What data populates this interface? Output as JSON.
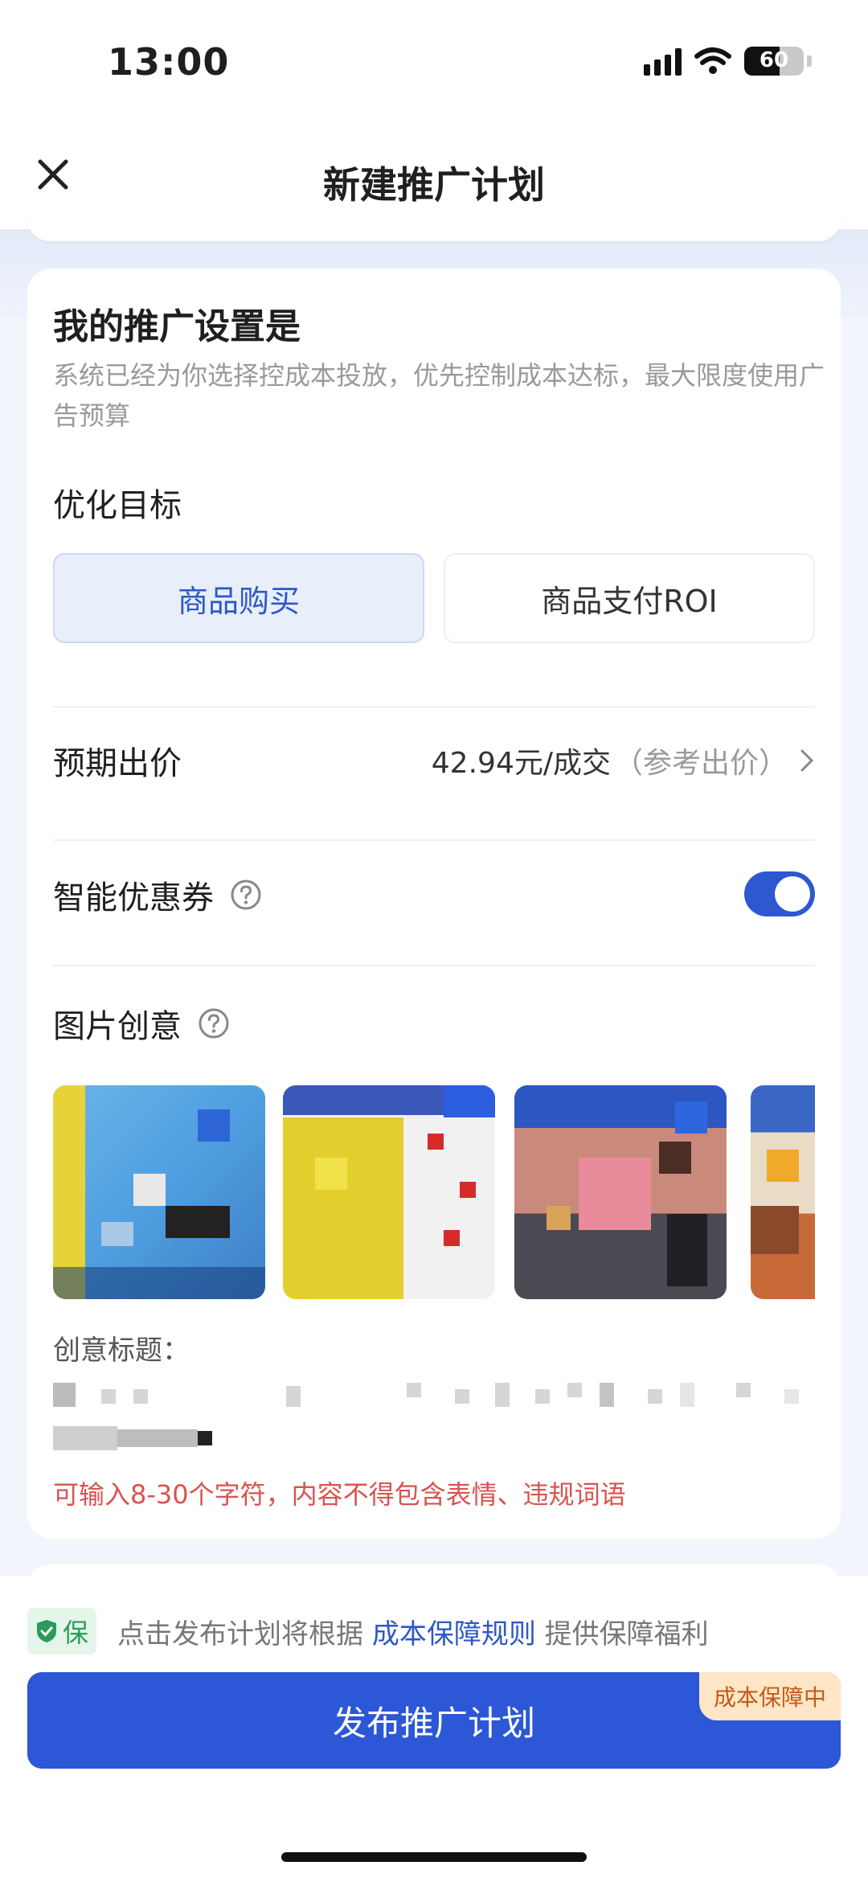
{
  "status_bar": {
    "time": "13:00",
    "battery": "60"
  },
  "nav": {
    "title": "新建推广计划"
  },
  "settings_card": {
    "title": "我的推广设置是",
    "description": "系统已经为你选择控成本投放，优先控制成本达标，最大限度使用广告预算",
    "optimization_goal": {
      "label": "优化目标",
      "options": [
        "商品购买",
        "商品支付ROI"
      ],
      "selected": "商品购买"
    },
    "expected_bid": {
      "label": "预期出价",
      "price": "42.94元/成交",
      "reference": "（参考出价）"
    },
    "smart_coupon": {
      "label": "智能优惠券",
      "enabled": true
    },
    "image_creative": {
      "label": "图片创意",
      "thumbnail_count": 4
    },
    "creative_title": {
      "label": "创意标题："
    },
    "hint": "可输入8-30个字符，内容不得包含表情、违规词语"
  },
  "bottom": {
    "badge": "保",
    "guarantee_prefix": "点击发布计划将根据",
    "guarantee_link": "成本保障规则",
    "guarantee_suffix": "提供保障福利",
    "publish_button": "发布推广计划",
    "corner_tag": "成本保障中"
  },
  "colors": {
    "primary": "#2c57d6",
    "hint": "#d9534f",
    "badge_green": "#2c9a59",
    "tag_orange": "#c25a17"
  }
}
